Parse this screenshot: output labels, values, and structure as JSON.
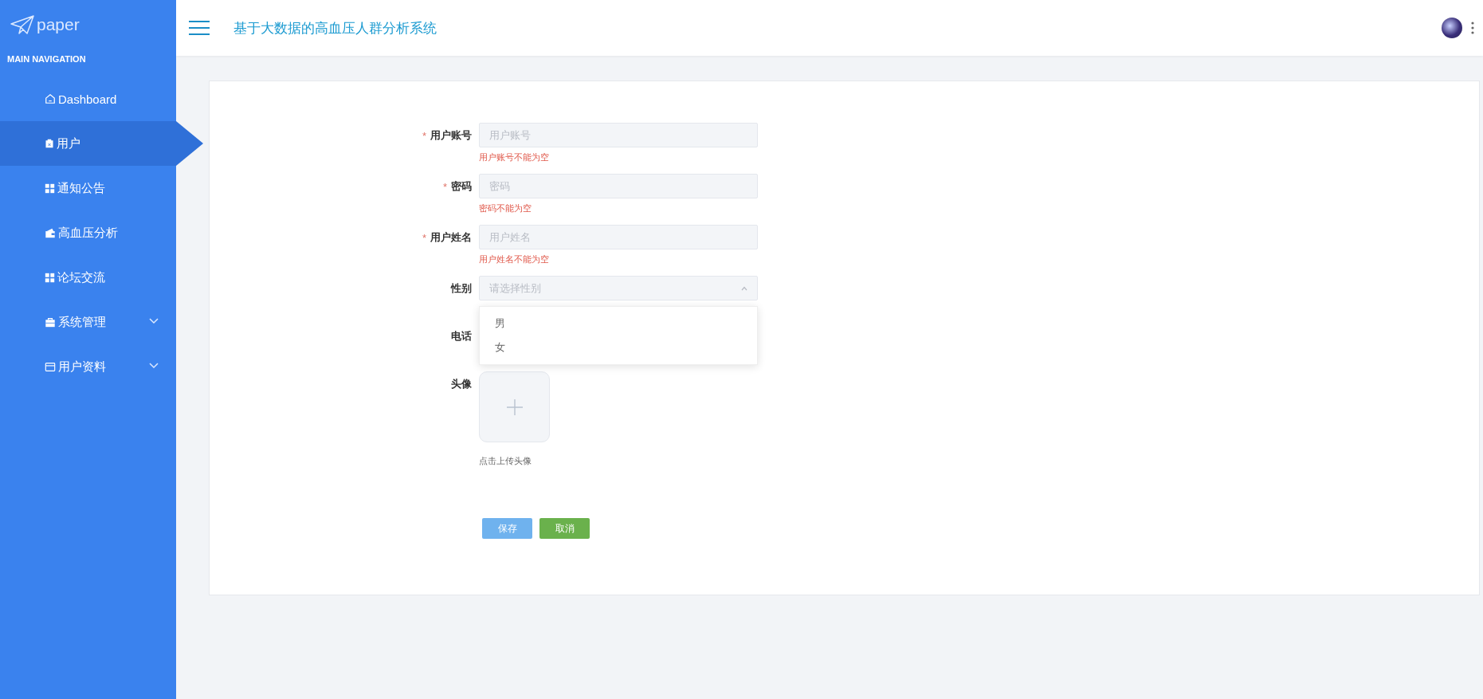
{
  "sidebar": {
    "logo": "paper",
    "heading": "MAIN NAVIGATION",
    "items": [
      {
        "label": "Dashboard",
        "selected": false
      },
      {
        "label": "用户",
        "selected": true
      },
      {
        "label": "通知公告",
        "selected": false
      },
      {
        "label": "高血压分析",
        "selected": false
      },
      {
        "label": "论坛交流",
        "selected": false
      },
      {
        "label": "系统管理",
        "selected": false,
        "expandable": true
      },
      {
        "label": "用户资料",
        "selected": false,
        "expandable": true
      }
    ]
  },
  "header": {
    "title": "基于大数据的高血压人群分析系统"
  },
  "form": {
    "fields": [
      {
        "kind": "input",
        "label": "用户账号",
        "required_mark": "*",
        "placeholder": "用户账号",
        "error": "用户账号不能为空"
      },
      {
        "kind": "input",
        "label": "密码",
        "required_mark": "*",
        "placeholder": "密码",
        "error": "密码不能为空"
      },
      {
        "kind": "input",
        "label": "用户姓名",
        "required_mark": "*",
        "placeholder": "用户姓名",
        "error": "用户姓名不能为空"
      },
      {
        "kind": "select",
        "label": "性别",
        "placeholder": "请选择性别",
        "expanded": true,
        "options": [
          "男",
          "女"
        ]
      },
      {
        "kind": "input",
        "label": "电话"
      },
      {
        "kind": "upload",
        "label": "头像",
        "hint": "点击上传头像"
      }
    ],
    "buttons": [
      {
        "label": "保存",
        "kind": "primary"
      },
      {
        "label": "取消",
        "kind": "success"
      }
    ]
  }
}
